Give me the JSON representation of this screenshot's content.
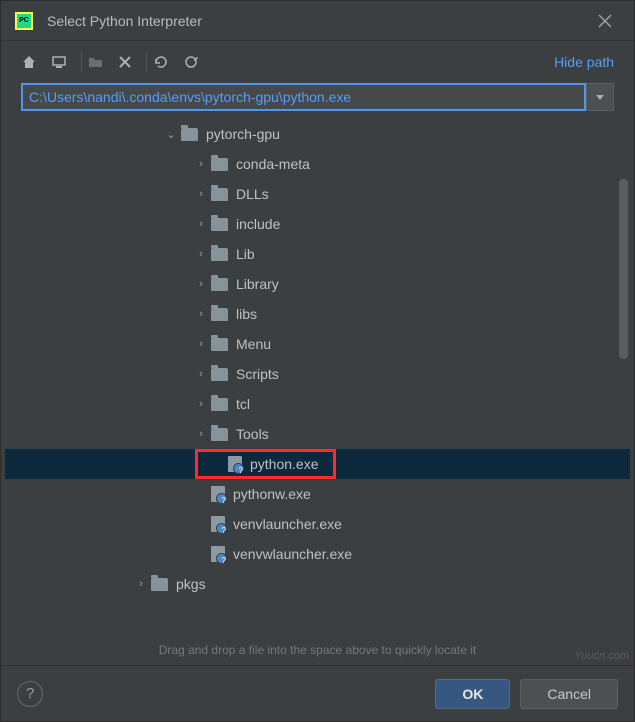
{
  "title": "Select Python Interpreter",
  "hide_path": "Hide path",
  "path": "C:\\Users\\nandi\\.conda\\envs\\pytorch-gpu\\python.exe",
  "tree": [
    {
      "type": "folder",
      "name": "pytorch-gpu",
      "depth": 0,
      "expanded": true
    },
    {
      "type": "folder",
      "name": "conda-meta",
      "depth": 1,
      "expanded": false
    },
    {
      "type": "folder",
      "name": "DLLs",
      "depth": 1,
      "expanded": false
    },
    {
      "type": "folder",
      "name": "include",
      "depth": 1,
      "expanded": false
    },
    {
      "type": "folder",
      "name": "Lib",
      "depth": 1,
      "expanded": false
    },
    {
      "type": "folder",
      "name": "Library",
      "depth": 1,
      "expanded": false
    },
    {
      "type": "folder",
      "name": "libs",
      "depth": 1,
      "expanded": false
    },
    {
      "type": "folder",
      "name": "Menu",
      "depth": 1,
      "expanded": false
    },
    {
      "type": "folder",
      "name": "Scripts",
      "depth": 1,
      "expanded": false
    },
    {
      "type": "folder",
      "name": "tcl",
      "depth": 1,
      "expanded": false
    },
    {
      "type": "folder",
      "name": "Tools",
      "depth": 1,
      "expanded": false
    },
    {
      "type": "file",
      "name": "python.exe",
      "depth": 1,
      "selected": true,
      "highlighted": true
    },
    {
      "type": "file",
      "name": "pythonw.exe",
      "depth": 1
    },
    {
      "type": "file",
      "name": "venvlauncher.exe",
      "depth": 1
    },
    {
      "type": "file",
      "name": "venvwlauncher.exe",
      "depth": 1
    },
    {
      "type": "folder",
      "name": "pkgs",
      "depth": -1,
      "expanded": false
    }
  ],
  "hint": "Drag and drop a file into the space above to quickly locate it",
  "ok": "OK",
  "cancel": "Cancel",
  "watermark": "Yuucn.com"
}
